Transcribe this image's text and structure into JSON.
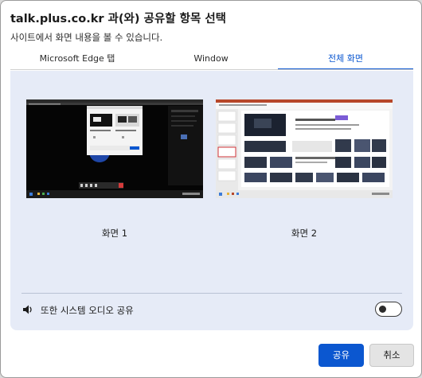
{
  "dialog": {
    "title": "talk.plus.co.kr 과(와) 공유할 항목 선택",
    "subtitle": "사이트에서 화면 내용을 볼 수 있습니다."
  },
  "tabs": [
    {
      "label": "Microsoft Edge 탭",
      "selected": false
    },
    {
      "label": "Window",
      "selected": false
    },
    {
      "label": "전체 화면",
      "selected": true
    }
  ],
  "screens": [
    {
      "label": "화면 1",
      "thumbnail": "desktop-screenshot-dark"
    },
    {
      "label": "화면 2",
      "thumbnail": "desktop-screenshot-presentation"
    }
  ],
  "audio": {
    "label": "또한 시스템 오디오 공유",
    "icon": "speaker-icon",
    "enabled": false
  },
  "buttons": {
    "share": "공유",
    "cancel": "취소"
  },
  "colors": {
    "accent": "#0b57d0",
    "panel": "#e6ebf7"
  }
}
